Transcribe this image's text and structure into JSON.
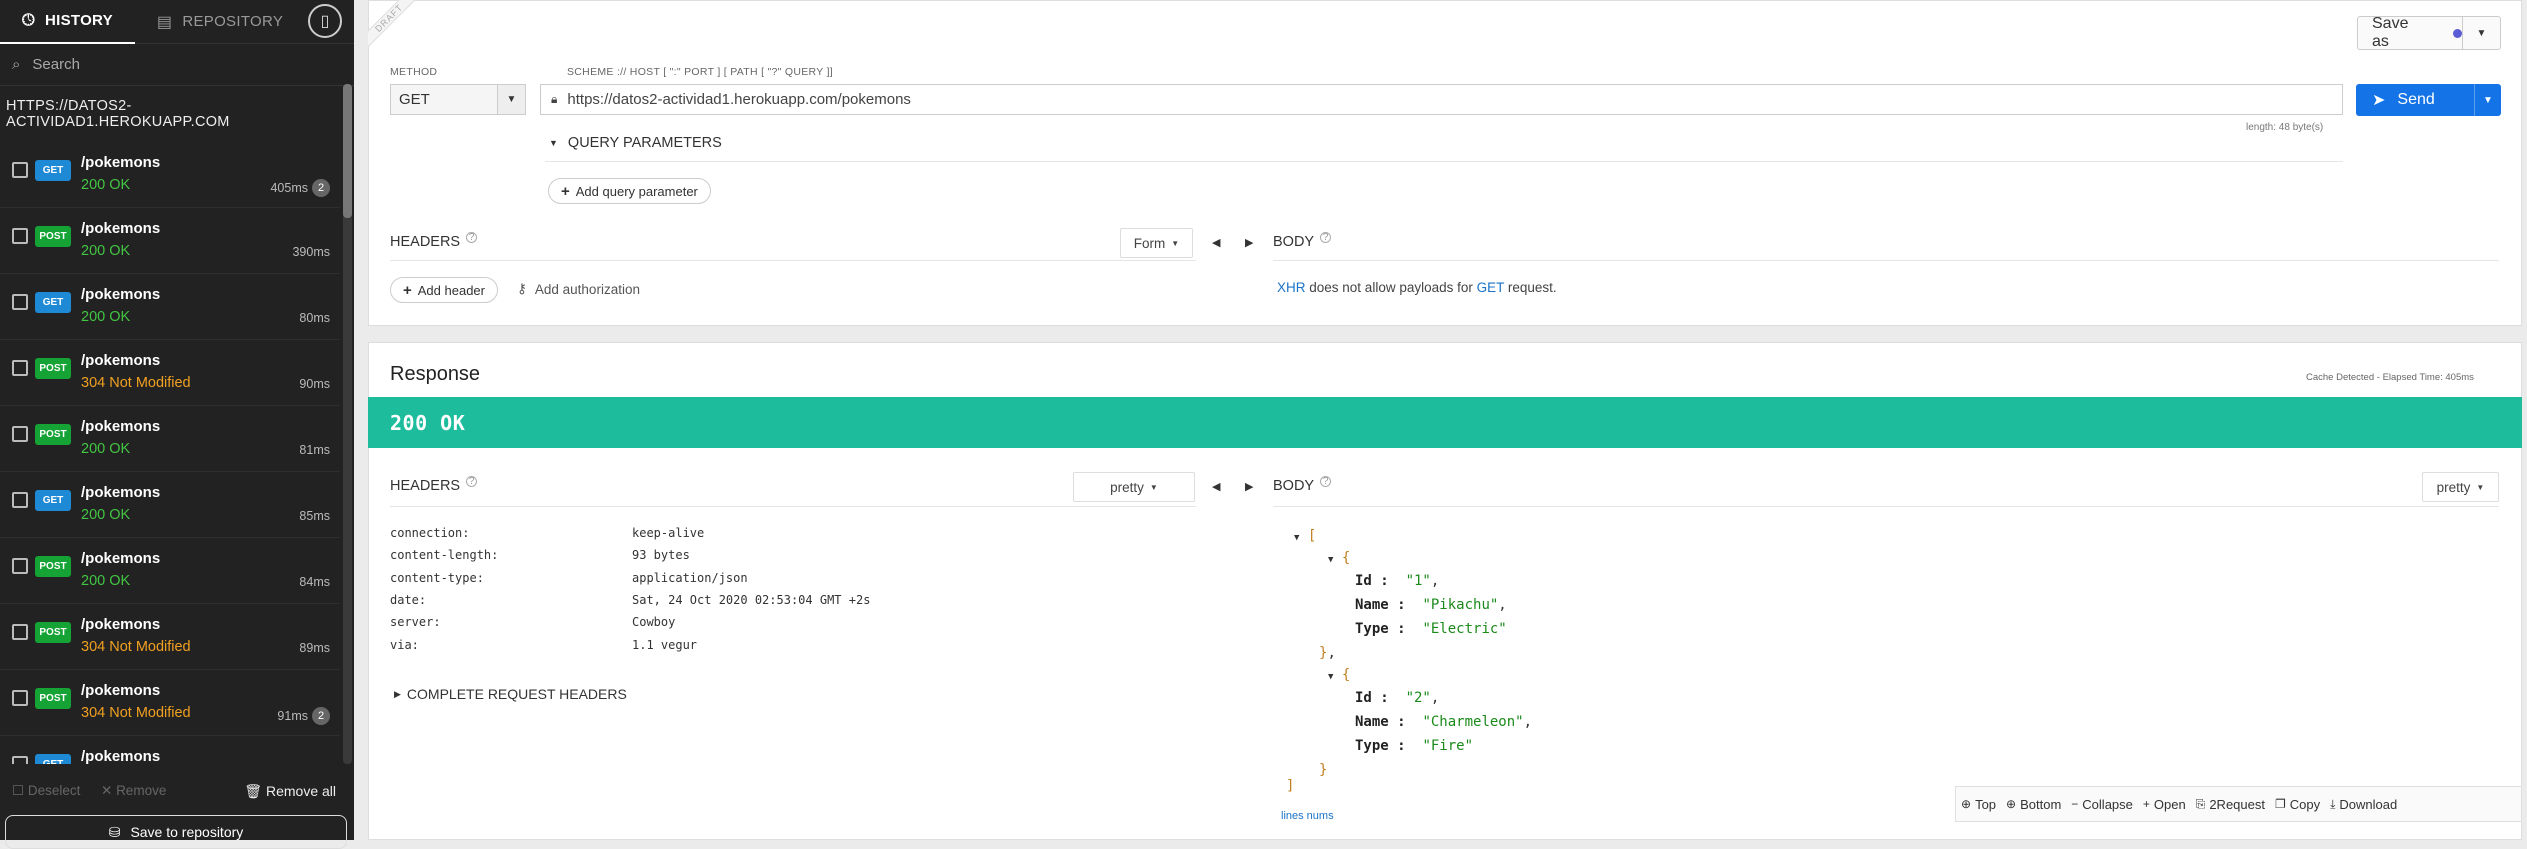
{
  "sidebar": {
    "tabs": [
      {
        "label": "HISTORY",
        "icon": "history-icon",
        "active": true
      },
      {
        "label": "REPOSITORY",
        "icon": "repository-icon",
        "active": false
      }
    ],
    "search_placeholder": "Search",
    "host": "HTTPS://DATOS2-ACTIVIDAD1.HEROKUAPP.COM",
    "items": [
      {
        "method": "GET",
        "path": "/pokemons",
        "status": "200 OK",
        "time": "405ms",
        "count": "2"
      },
      {
        "method": "POST",
        "path": "/pokemons",
        "status": "200 OK",
        "time": "390ms",
        "count": ""
      },
      {
        "method": "GET",
        "path": "/pokemons",
        "status": "200 OK",
        "time": "80ms",
        "count": ""
      },
      {
        "method": "POST",
        "path": "/pokemons",
        "status": "304 Not Modified",
        "time": "90ms",
        "count": ""
      },
      {
        "method": "POST",
        "path": "/pokemons",
        "status": "200 OK",
        "time": "81ms",
        "count": ""
      },
      {
        "method": "GET",
        "path": "/pokemons",
        "status": "200 OK",
        "time": "85ms",
        "count": ""
      },
      {
        "method": "POST",
        "path": "/pokemons",
        "status": "200 OK",
        "time": "84ms",
        "count": ""
      },
      {
        "method": "POST",
        "path": "/pokemons",
        "status": "304 Not Modified",
        "time": "89ms",
        "count": ""
      },
      {
        "method": "POST",
        "path": "/pokemons",
        "status": "304 Not Modified",
        "time": "91ms",
        "count": "2"
      },
      {
        "method": "GET",
        "path": "/pokemons",
        "status": "",
        "time": "",
        "count": ""
      }
    ],
    "deselect_label": "Deselect",
    "remove_label": "Remove",
    "remove_all_label": "Remove all",
    "save_repo_label": "Save to repository"
  },
  "request": {
    "draft_label": "DRAFT",
    "save_as_label": "Save as",
    "method_label": "METHOD",
    "method_value": "GET",
    "url_label": "SCHEME :// HOST [ \":\" PORT ] [ PATH [ \"?\" QUERY ]]",
    "url_value": "https://datos2-actividad1.herokuapp.com/pokemons",
    "length": "length: 48 byte(s)",
    "send_label": "Send",
    "query_params_label": "QUERY PARAMETERS",
    "add_query_param_label": "Add query parameter",
    "headers_label": "HEADERS",
    "headers_mode": "Form",
    "add_header_label": "Add header",
    "add_auth_label": "Add authorization",
    "body_label": "BODY",
    "body_note": {
      "xhr": "XHR",
      "mid": " does not allow payloads for ",
      "method": "GET",
      "end": " request."
    }
  },
  "response": {
    "title": "Response",
    "cache_note": "Cache Detected - Elapsed Time: 405ms",
    "status": "200 OK",
    "headers_label": "HEADERS",
    "headers_mode": "pretty",
    "body_label": "BODY",
    "body_mode": "pretty",
    "headers": [
      {
        "k": "connection:",
        "v": "keep-alive"
      },
      {
        "k": "content-length:",
        "v": "93 bytes"
      },
      {
        "k": "content-type:",
        "v": "application/json"
      },
      {
        "k": "date:",
        "v": "Sat, 24 Oct 2020 02:53:04 GMT +2s"
      },
      {
        "k": "server:",
        "v": "Cowboy"
      },
      {
        "k": "via:",
        "v": "1.1 vegur"
      }
    ],
    "complete_headers_label": "COMPLETE REQUEST HEADERS",
    "body_json": [
      {
        "Id": "\"1\"",
        "Name": "\"Pikachu\"",
        "Type": "\"Electric\""
      },
      {
        "Id": "\"2\"",
        "Name": "\"Charmeleon\"",
        "Type": "\"Fire\""
      }
    ],
    "line_nums_label": "lines nums",
    "toolbar": [
      {
        "label": "Top",
        "icon": "⊕",
        "name": "top-button"
      },
      {
        "label": "Bottom",
        "icon": "⊕",
        "name": "bottom-button"
      },
      {
        "label": "Collapse",
        "icon": "−",
        "name": "collapse-button"
      },
      {
        "label": "Open",
        "icon": "+",
        "name": "open-button"
      },
      {
        "label": "2Request",
        "icon": "⎘",
        "name": "to-request-button"
      },
      {
        "label": "Copy",
        "icon": "❐",
        "name": "copy-button"
      },
      {
        "label": "Download",
        "icon": "⤓",
        "name": "download-button"
      }
    ]
  }
}
